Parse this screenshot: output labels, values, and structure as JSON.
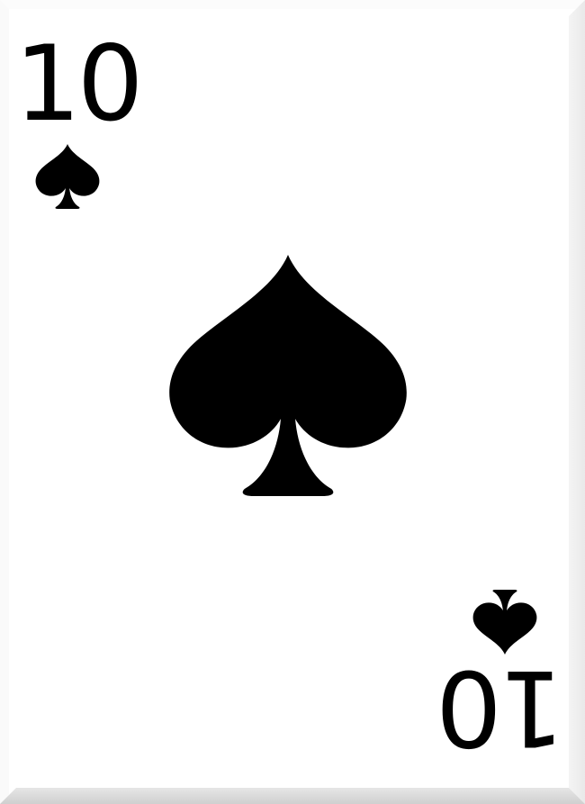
{
  "card": {
    "rank": "10",
    "suit": "spades",
    "suit_icon": "spade-icon",
    "color": "#000000"
  }
}
